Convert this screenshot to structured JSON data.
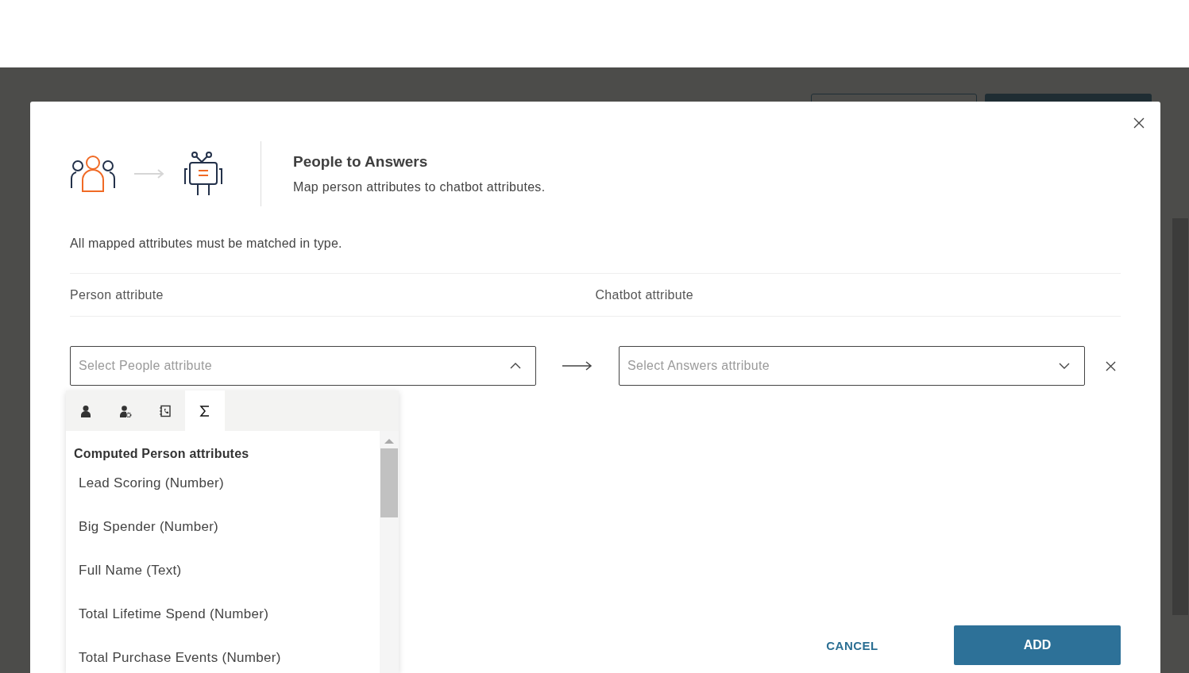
{
  "dialog": {
    "title": "People to Answers",
    "subtitle": "Map person attributes to chatbot attributes.",
    "note": "All mapped attributes must be matched in type.",
    "columns": [
      "Person attribute",
      "Chatbot attribute"
    ],
    "mapping": {
      "source": {
        "placeholder": "Select People attribute",
        "expanded": true
      },
      "target": {
        "placeholder": "Select Answers attribute",
        "expanded": false
      }
    },
    "dropdown": {
      "tabs": [
        {
          "kind": "person",
          "selected": false
        },
        {
          "kind": "person-settings",
          "selected": false
        },
        {
          "kind": "contact-book",
          "selected": false
        },
        {
          "kind": "sum",
          "selected": true
        }
      ],
      "group_title": "Computed Person attributes",
      "items": [
        "Lead Scoring (Number)",
        "Big Spender (Number)",
        "Full Name (Text)",
        "Total Lifetime Spend (Number)",
        "Total Purchase Events (Number)"
      ]
    },
    "buttons": {
      "cancel": "CANCEL",
      "add": "ADD"
    }
  }
}
